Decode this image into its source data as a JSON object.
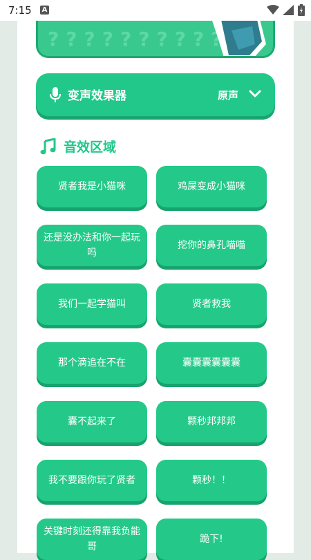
{
  "status_bar": {
    "time": "7:15",
    "notification_letter": "A"
  },
  "voice_effect": {
    "title": "变声效果器",
    "value": "原声"
  },
  "sound_section": {
    "title": "音效区域"
  },
  "sounds": [
    "贤者我是小猫咪",
    "鸡屎变成小猫咪",
    "还是没办法和你一起玩吗",
    "挖你的鼻孔喵喵",
    "我们一起学猫叫",
    "贤者救我",
    "那个滴追在不在",
    "囊囊囊囊囊囊",
    "囊不起来了",
    "颗秒邦邦邦",
    "我不要跟你玩了贤者",
    "颗秒！！",
    "关键时刻还得靠我负能哥",
    "跪下!"
  ],
  "colors": {
    "accent": "#21c889",
    "accent_dark": "#17a36e",
    "banner": "#39c98f"
  }
}
